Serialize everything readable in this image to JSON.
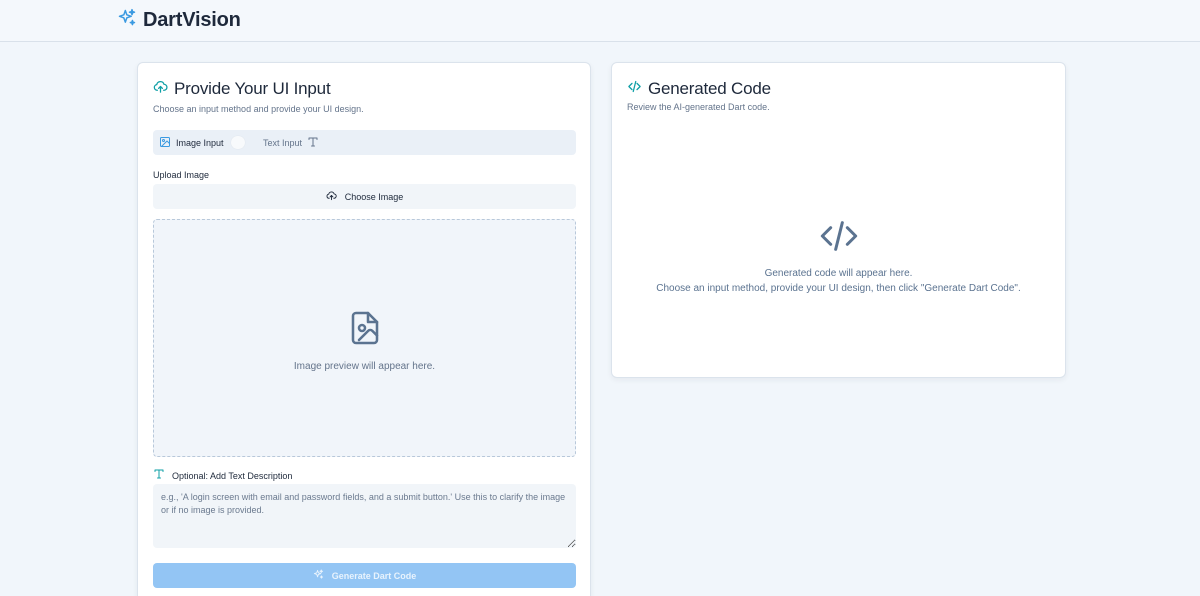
{
  "app": {
    "title": "DartVision",
    "logo_icon": "sparkles-icon",
    "accent_color": "#3b9ae1"
  },
  "input_panel": {
    "title": "Provide Your UI Input",
    "description": "Choose an input method and provide your UI design.",
    "icon": "cloud-upload-icon",
    "toggle": {
      "image_label": "Image Input",
      "text_label": "Text Input",
      "selected": "Image Input"
    },
    "upload_label": "Upload Image",
    "choose_button_label": "Choose Image",
    "preview_placeholder": "Image preview will appear here.",
    "description_label": "Optional: Add Text Description",
    "description_placeholder": "e.g., 'A login screen with email and password fields, and a submit button.' Use this to clarify the image or if no image is provided.",
    "generate_button_label": "Generate Dart Code"
  },
  "output_panel": {
    "title": "Generated Code",
    "description": "Review the AI-generated Dart code.",
    "icon": "code-icon",
    "empty_line1": "Generated code will appear here.",
    "empty_line2": "Choose an input method, provide your UI design, then click \"Generate Dart Code\"."
  }
}
